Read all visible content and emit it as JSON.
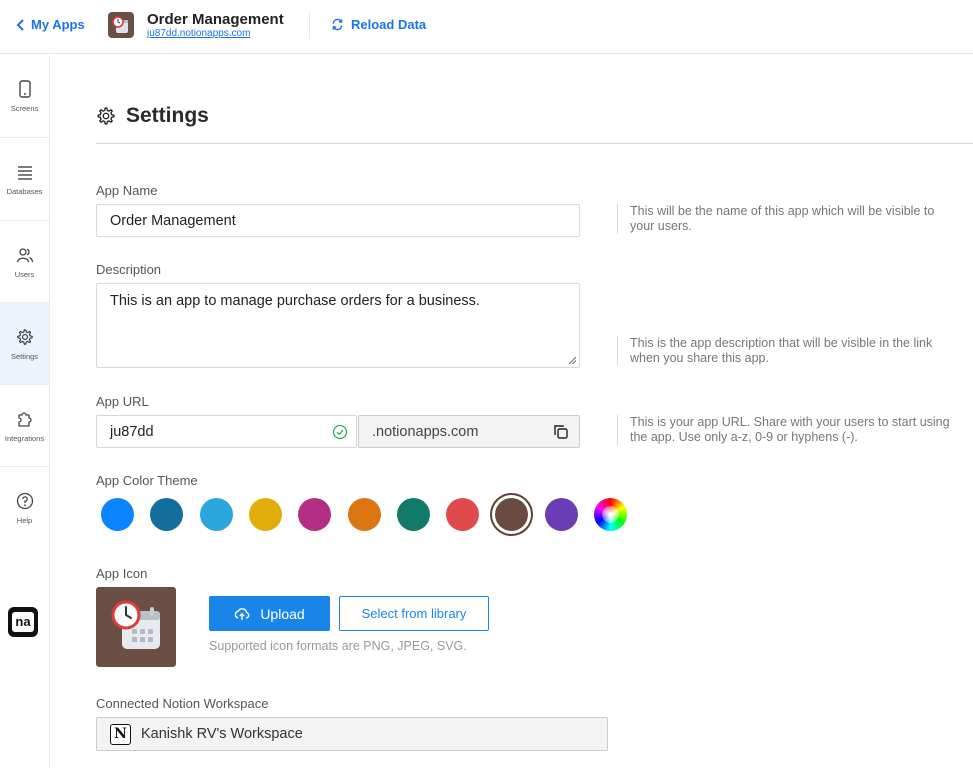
{
  "header": {
    "back_label": "My Apps",
    "app_title": "Order Management",
    "app_domain": "ju87dd.notionapps.com",
    "reload_label": "Reload Data"
  },
  "sidebar": {
    "items": [
      {
        "label": "Screens",
        "icon": "phone-icon"
      },
      {
        "label": "Databases",
        "icon": "list-icon"
      },
      {
        "label": "Users",
        "icon": "users-icon"
      },
      {
        "label": "Settings",
        "icon": "gear-icon",
        "active": true
      },
      {
        "label": "Integrations",
        "icon": "puzzle-icon"
      },
      {
        "label": "Help",
        "icon": "help-icon"
      }
    ],
    "logo_text": "na"
  },
  "settings": {
    "title": "Settings",
    "app_name": {
      "label": "App Name",
      "value": "Order Management",
      "help": "This will be the name of this app which will be visible to your users."
    },
    "description": {
      "label": "Description",
      "value": "This is an app to manage purchase orders for a business.",
      "help": "This is the app description that will be visible in the link when you share this app."
    },
    "app_url": {
      "label": "App URL",
      "value": "ju87dd",
      "suffix": ".notionapps.com",
      "help": "This is your app URL. Share with your users to start using the app. Use only a-z, 0-9 or hyphens (-)."
    },
    "theme": {
      "label": "App Color Theme",
      "colors": [
        "#0a84ff",
        "#136e9c",
        "#2ca5dc",
        "#e0ad0b",
        "#b52e85",
        "#dd7611",
        "#127a68",
        "#e14a4d",
        "#6a4b41",
        "#6c3cb4"
      ],
      "selected_index": 8,
      "custom_icon": "color-wheel-icon"
    },
    "app_icon": {
      "label": "App Icon",
      "upload_label": "Upload",
      "library_label": "Select from library",
      "formats": "Supported icon formats are PNG, JPEG, SVG."
    },
    "workspace": {
      "label": "Connected Notion Workspace",
      "value": "Kanishk RV's Workspace",
      "icon_letter": "N"
    }
  }
}
